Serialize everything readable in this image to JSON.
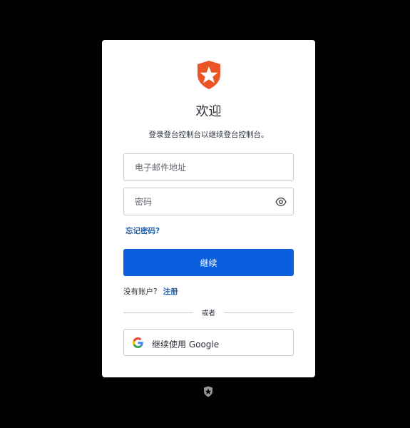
{
  "header": {
    "title": "欢迎",
    "subtitle": "登录登台控制台以继续登台控制台。"
  },
  "form": {
    "email_placeholder": "电子邮件地址",
    "password_placeholder": "密码",
    "forgot_password": "忘记密码?",
    "continue_label": "继续"
  },
  "signup": {
    "prompt": "没有账户?",
    "link": "注册"
  },
  "divider_text": "或者",
  "social": {
    "google_label": "继续使用 Google"
  },
  "colors": {
    "brand": "#eb5424",
    "primary_button": "#0b5fdf",
    "link": "#1f5fa8",
    "background": "#000000"
  },
  "icons": {
    "brand_logo": "auth0-shield-star-icon",
    "password_toggle": "eye-icon",
    "google": "google-icon",
    "footer": "auth0-shield-icon"
  }
}
